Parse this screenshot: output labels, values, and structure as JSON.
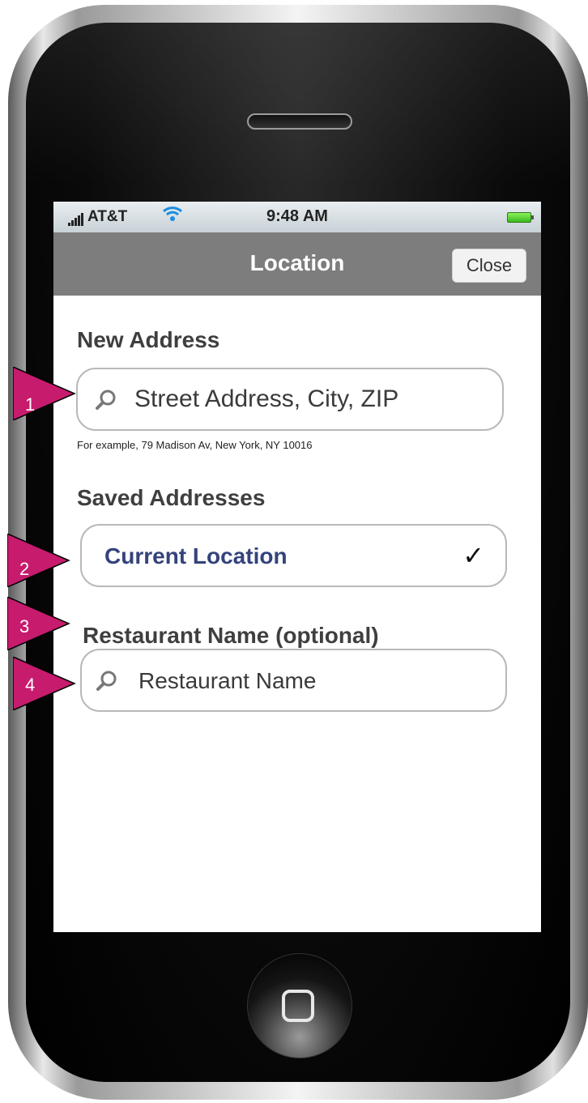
{
  "status_bar": {
    "carrier": "AT&T",
    "time": "9:48 AM"
  },
  "nav": {
    "title": "Location",
    "close_label": "Close"
  },
  "new_address": {
    "heading": "New Address",
    "placeholder": "Street Address, City, ZIP",
    "hint": "For example, 79 Madison Av, New York, NY  10016"
  },
  "saved_addresses": {
    "heading": "Saved Addresses",
    "current_location": "Current Location",
    "checkmark": "✓"
  },
  "restaurant": {
    "heading": "Restaurant Name (optional)",
    "placeholder": "Restaurant Name"
  },
  "callouts": [
    "1",
    "2",
    "3",
    "4"
  ],
  "colors": {
    "callout": "#c71b6e",
    "navbar": "#7d7d7d",
    "link_text": "#34437c"
  },
  "icons": [
    "search-icon",
    "wifi-icon",
    "signal-icon",
    "battery-icon",
    "checkmark-icon",
    "home-icon"
  ]
}
